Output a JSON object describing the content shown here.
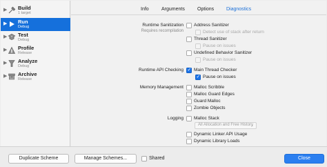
{
  "sidebar": {
    "items": [
      {
        "title": "Build",
        "subtitle": "1 target",
        "icon": "build-icon",
        "selected": false
      },
      {
        "title": "Run",
        "subtitle": "Debug",
        "icon": "run-icon",
        "selected": true
      },
      {
        "title": "Test",
        "subtitle": "Debug",
        "icon": "test-icon",
        "selected": false
      },
      {
        "title": "Profile",
        "subtitle": "Release",
        "icon": "profile-icon",
        "selected": false
      },
      {
        "title": "Analyze",
        "subtitle": "Debug",
        "icon": "analyze-icon",
        "selected": false
      },
      {
        "title": "Archive",
        "subtitle": "Release",
        "icon": "archive-icon",
        "selected": false
      }
    ]
  },
  "tabs": [
    {
      "label": "Info",
      "active": false
    },
    {
      "label": "Arguments",
      "active": false
    },
    {
      "label": "Options",
      "active": false
    },
    {
      "label": "Diagnostics",
      "active": true
    }
  ],
  "sections": {
    "runtime_sanitization": {
      "label": "Runtime Sanitization",
      "sublabel": "Requires recompilation",
      "options": {
        "address_sanitizer": "Address Sanitizer",
        "detect_use_of_stack": "Detect use of stack after return",
        "thread_sanitizer": "Thread Sanitizer",
        "thread_pause": "Pause on issues",
        "ub_sanitizer": "Undefined Behavior Sanitizer",
        "ub_pause": "Pause on issues"
      }
    },
    "runtime_api_checking": {
      "label": "Runtime API Checking",
      "options": {
        "main_thread_checker": "Main Thread Checker",
        "mtc_pause": "Pause on issues"
      }
    },
    "memory_management": {
      "label": "Memory Management",
      "options": {
        "malloc_scribble": "Malloc Scribble",
        "malloc_guard_edges": "Malloc Guard Edges",
        "guard_malloc": "Guard Malloc",
        "zombie_objects": "Zombie Objects"
      }
    },
    "logging": {
      "label": "Logging",
      "options": {
        "malloc_stack": "Malloc Stack",
        "malloc_stack_select": "All Allocation and Free History",
        "dynamic_linker_api_usage": "Dynamic Linker API Usage",
        "dynamic_library_loads": "Dynamic Library Loads"
      }
    }
  },
  "bottom": {
    "duplicate_scheme": "Duplicate Scheme",
    "manage_schemes": "Manage Schemes...",
    "shared": "Shared",
    "close": "Close"
  },
  "colors": {
    "accent": "#1570dc",
    "button_primary": "#2b7ff0"
  }
}
